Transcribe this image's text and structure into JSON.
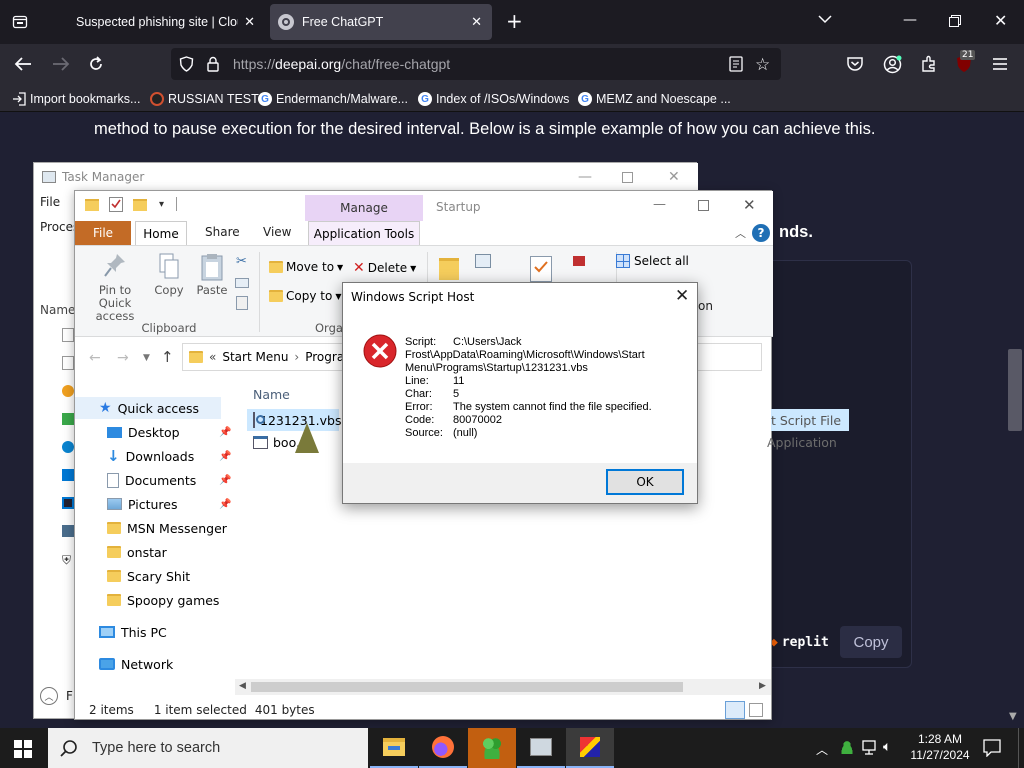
{
  "browser": {
    "tabs": [
      {
        "title": "Suspected phishing site | Cloudf"
      },
      {
        "title": "Free ChatGPT"
      }
    ],
    "url_prefix": "https://",
    "url_domain": "deepai.org",
    "url_path": "/chat/free-chatgpt",
    "bookmarks": [
      {
        "label": "Import bookmarks..."
      },
      {
        "label": "RUSSIAN TEST"
      },
      {
        "label": "Endermanch/Malware..."
      },
      {
        "label": "Index of /ISOs/Windows"
      },
      {
        "label": "MEMZ and Noescape ..."
      }
    ],
    "extension_badge": "21"
  },
  "page": {
    "paragraph": "method to pause execution for the desired interval. Below is a simple example of how you can achieve this.",
    "fragment": "nds.",
    "replit_label": "replit",
    "copy_label": "Copy"
  },
  "task_manager": {
    "title": "Task Manager",
    "menu_file": "File",
    "tab_processes": "Proces",
    "col_name": "Name",
    "footer": "F"
  },
  "explorer": {
    "manage_label": "Manage",
    "startup_label": "Startup",
    "tabs": {
      "file": "File",
      "home": "Home",
      "share": "Share",
      "view": "View",
      "app_tools": "Application Tools"
    },
    "ribbon": {
      "pin": "Pin to Quick access",
      "copy": "Copy",
      "paste": "Paste",
      "clipboard_group": "Clipboard",
      "move_to": "Move to",
      "delete": "Delete",
      "copy_to": "Copy to",
      "organize_group": "Orga",
      "select_all": "Select all",
      "open_fragment": "on"
    },
    "address": {
      "root": "Start Menu",
      "next": "Program"
    },
    "nav": {
      "quick_access": "Quick access",
      "items": [
        {
          "label": "Desktop",
          "pinned": true
        },
        {
          "label": "Downloads",
          "pinned": true
        },
        {
          "label": "Documents",
          "pinned": true
        },
        {
          "label": "Pictures",
          "pinned": true
        },
        {
          "label": "MSN Messenger",
          "pinned": false
        },
        {
          "label": "onstar",
          "pinned": false
        },
        {
          "label": "Scary Shit",
          "pinned": false
        },
        {
          "label": "Spoopy games",
          "pinned": false
        }
      ],
      "this_pc": "This PC",
      "network": "Network"
    },
    "file_header": "Name",
    "files": [
      {
        "name": "1231231.vbs",
        "type": "t Script File",
        "selected": true
      },
      {
        "name": "boo.l",
        "type": "Application",
        "selected": false
      }
    ],
    "status": {
      "count": "2 items",
      "selected": "1 item selected",
      "size": "401 bytes"
    }
  },
  "dialog": {
    "title": "Windows Script Host",
    "script_label": "Script:",
    "script_value": [
      "C:\\Users\\Jack",
      "Frost\\AppData\\Roaming\\Microsoft\\Windows\\Start",
      "Menu\\Programs\\Startup\\1231231.vbs"
    ],
    "line_label": "Line:",
    "line_value": "11",
    "char_label": "Char:",
    "char_value": "5",
    "error_label": "Error:",
    "error_value": "The system cannot find the file specified.",
    "code_label": "Code:",
    "code_value": "80070002",
    "source_label": "Source:",
    "source_value": "(null)",
    "ok_label": "OK"
  },
  "taskbar": {
    "search_placeholder": "Type here to search",
    "time": "1:28 AM",
    "date": "11/27/2024"
  }
}
